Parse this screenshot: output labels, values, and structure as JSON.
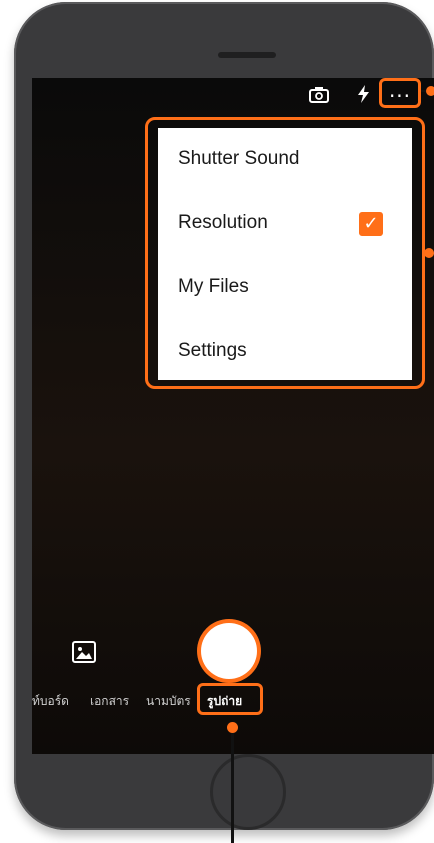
{
  "top_bar": {
    "more_label": "...",
    "flash_icon": "flash-auto-icon",
    "camera_switch_icon": "camera-switch-icon"
  },
  "menu": {
    "items": [
      {
        "label": "Shutter Sound"
      },
      {
        "label": "Resolution",
        "checked": true
      },
      {
        "label": "My Files"
      },
      {
        "label": "Settings"
      }
    ]
  },
  "modes": {
    "items": [
      "ท์บอร์ด",
      "เอกสาร",
      "นามบัตร"
    ],
    "selected": "รูปถ่าย"
  },
  "colors": {
    "accent": "#ff6f18",
    "screen_bg": "#120d0a",
    "phone_body": "#3a3a3c"
  }
}
